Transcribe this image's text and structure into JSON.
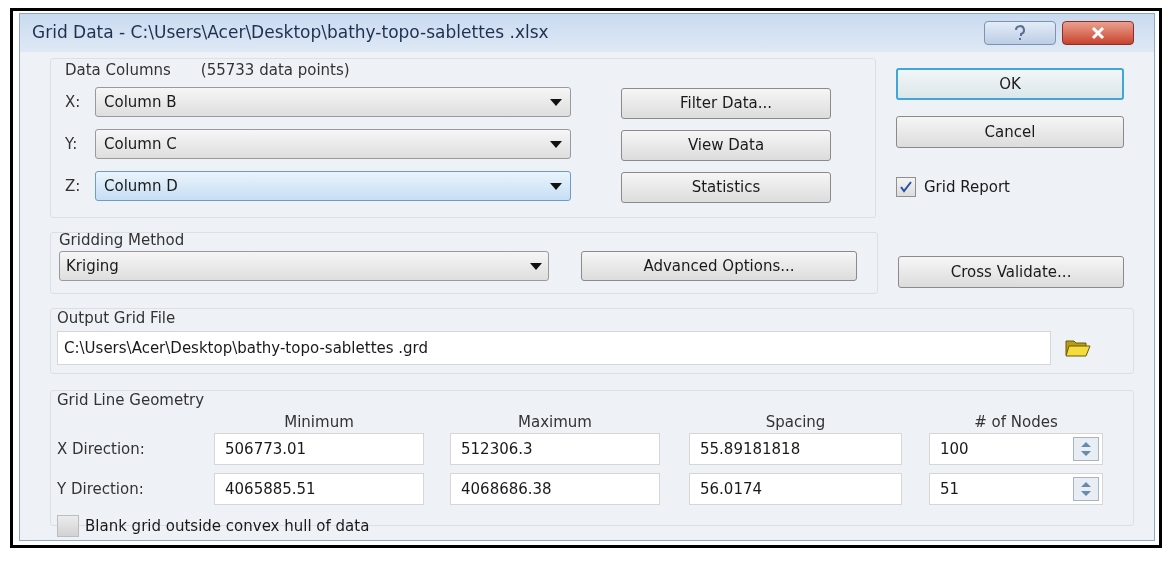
{
  "window": {
    "title": "Grid Data - C:\\Users\\Acer\\Desktop\\bathy-topo-sablettes .xlsx"
  },
  "data_columns": {
    "title": "Data Columns",
    "count": "(55733 data points)",
    "fields": [
      {
        "label": "X:",
        "value": "Column B",
        "focused": false
      },
      {
        "label": "Y:",
        "value": "Column C",
        "focused": false
      },
      {
        "label": "Z:",
        "value": "Column D",
        "focused": true
      }
    ]
  },
  "data_buttons": [
    "Filter Data...",
    "View Data",
    "Statistics"
  ],
  "dialog_buttons": [
    {
      "label": "OK",
      "default": true
    },
    {
      "label": "Cancel",
      "default": false
    }
  ],
  "grid_report": {
    "label": "Grid Report",
    "checked": true
  },
  "gridding_method": {
    "title": "Gridding Method",
    "value": "Kriging",
    "buttons": [
      "Advanced Options...",
      "Cross Validate..."
    ]
  },
  "output_grid_file": {
    "title": "Output Grid File",
    "value": "C:\\Users\\Acer\\Desktop\\bathy-topo-sablettes .grd"
  },
  "geometry": {
    "title": "Grid Line Geometry",
    "columns": [
      "Minimum",
      "Maximum",
      "Spacing",
      "# of Nodes"
    ],
    "rows": [
      {
        "label": "X Direction:",
        "values": [
          "506773.01",
          "512306.3",
          "55.89181818",
          "100"
        ]
      },
      {
        "label": "Y Direction:",
        "values": [
          "4065885.51",
          "4068686.38",
          "56.0174",
          "51"
        ]
      }
    ]
  },
  "blank_outside_hull": {
    "label": "Blank grid outside convex hull of data",
    "checked": false
  }
}
